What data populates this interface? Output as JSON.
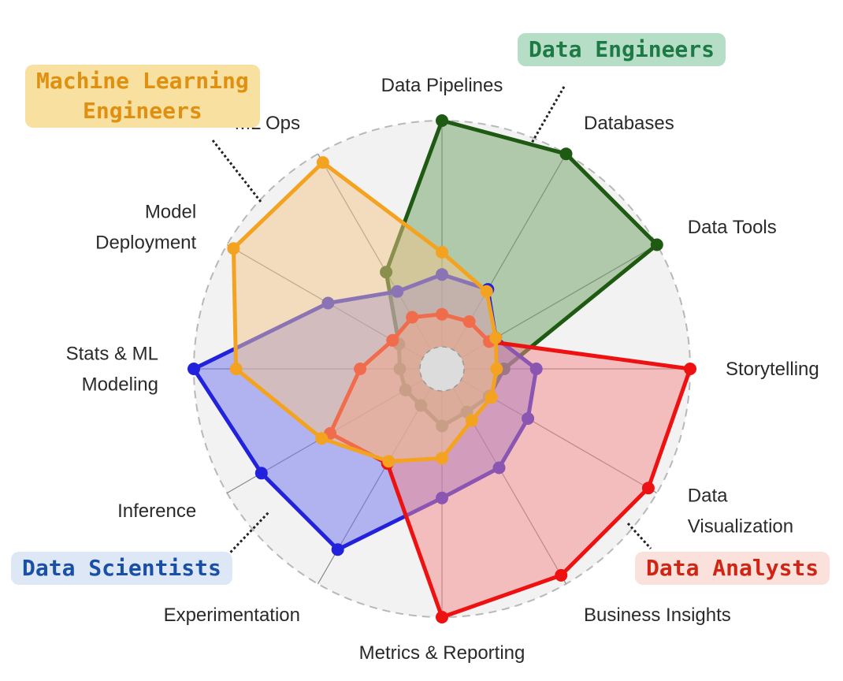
{
  "chart_data": {
    "type": "radar",
    "axes": [
      "Data Pipelines",
      "Databases",
      "Data Tools",
      "Storytelling",
      "Data Visualization",
      "Business Insights",
      "Metrics & Reporting",
      "Experimentation",
      "Inference",
      "Stats & ML Modeling",
      "Model Deployment",
      "ML Ops"
    ],
    "axis_label_lines": [
      [
        "Data Pipelines"
      ],
      [
        "Databases"
      ],
      [
        "Data Tools"
      ],
      [
        "Storytelling"
      ],
      [
        "Data",
        "Visualization"
      ],
      [
        "Business Insights"
      ],
      [
        "Metrics & Reporting"
      ],
      [
        "Experimentation"
      ],
      [
        "Inference"
      ],
      [
        "Stats & ML",
        "Modeling"
      ],
      [
        "Model",
        "Deployment"
      ],
      [
        "ML Ops"
      ]
    ],
    "rlim": [
      0,
      1
    ],
    "series": [
      {
        "name": "Data Engineers",
        "color": "#1e5a12",
        "fill": "#6e9f64",
        "values": [
          1.0,
          1.0,
          1.0,
          0.25,
          0.22,
          0.2,
          0.23,
          0.17,
          0.17,
          0.17,
          0.2,
          0.45
        ]
      },
      {
        "name": "Data Scientists",
        "color": "#2222dd",
        "fill": "#6f74f0",
        "values": [
          0.38,
          0.37,
          0.25,
          0.38,
          0.4,
          0.46,
          0.52,
          0.84,
          0.84,
          1.0,
          0.53,
          0.36
        ]
      },
      {
        "name": "Data Analysts",
        "color": "#ee1111",
        "fill": "#f48888",
        "values": [
          0.22,
          0.22,
          0.22,
          1.0,
          0.96,
          0.96,
          1.0,
          0.44,
          0.52,
          0.33,
          0.23,
          0.24
        ]
      },
      {
        "name": "Machine Learning Engineers",
        "color": "#f4a320",
        "fill": "#f4c58a",
        "values": [
          0.47,
          0.36,
          0.25,
          0.22,
          0.23,
          0.24,
          0.36,
          0.43,
          0.56,
          0.83,
          0.97,
          0.96
        ]
      }
    ]
  },
  "callouts": {
    "data_engineers": {
      "lines": [
        "Data Engineers"
      ],
      "color": "#1d7a45",
      "bg": "#b6dec7"
    },
    "ml_engineers": {
      "lines": [
        "Machine Learning",
        "Engineers"
      ],
      "color": "#e09010",
      "bg": "#f8e0a0"
    },
    "data_scientists": {
      "lines": [
        "Data Scientists"
      ],
      "color": "#1a4fa6",
      "bg": "#dde7f5"
    },
    "data_analysts": {
      "lines": [
        "Data Analysts"
      ],
      "color": "#d02514",
      "bg": "#fbe1dc"
    }
  }
}
